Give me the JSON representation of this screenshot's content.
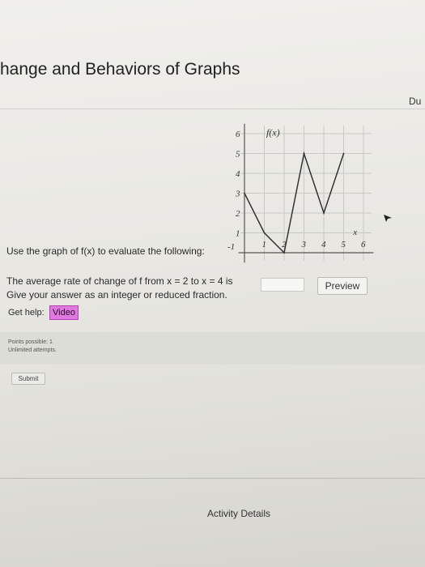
{
  "header": {
    "title": "hange and Behaviors of Graphs",
    "due_label": "Du"
  },
  "graph": {
    "function_label": "f(x)",
    "y_ticks": [
      "6",
      "5",
      "4",
      "3",
      "2",
      "1",
      "-1"
    ],
    "x_ticks": [
      "1",
      "2",
      "3",
      "4",
      "5",
      "6"
    ],
    "x_neg_label": "-1",
    "x_axis_label": "x",
    "points": [
      [
        0,
        3
      ],
      [
        1,
        1
      ],
      [
        2,
        0
      ],
      [
        3,
        5
      ],
      [
        4,
        2
      ],
      [
        5,
        5
      ]
    ]
  },
  "question": {
    "intro": "Use the graph of f(x) to evaluate the following:",
    "line1": "The average rate of change of f from x = 2 to x = 4 is",
    "line2": "Give your answer as an integer or reduced fraction.",
    "answer_value": "",
    "preview_label": "Preview"
  },
  "help": {
    "label": "Get help:",
    "video_label": "Video"
  },
  "meta": {
    "points_possible": "Points possible: 1",
    "attempts": "Unlimited attempts."
  },
  "submit_label": "Submit",
  "footer": {
    "activity_details": "Activity Details"
  }
}
